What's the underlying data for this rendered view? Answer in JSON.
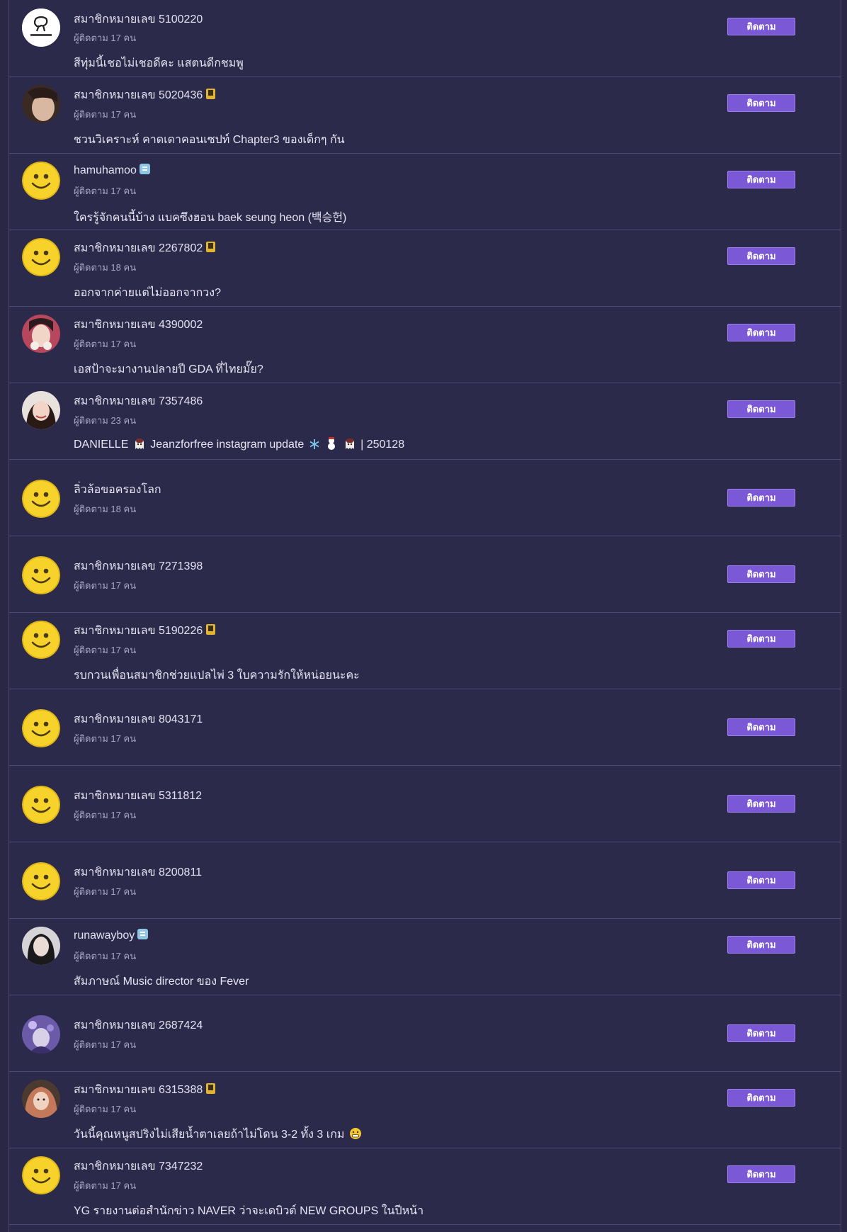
{
  "follow_label": "ติดตาม",
  "members": [
    {
      "name": "สมาชิกหมายเลข 5100220",
      "followers": "ผู้ติดตาม 17 คน",
      "topic": "สีทุ่มนี้เชอไม่เชอดีคะ แสตนดีกชมพู",
      "avatar": "logo-avatar",
      "badge": null
    },
    {
      "name": "สมาชิกหมายเลข 5020436",
      "followers": "ผู้ติดตาม 17 คน",
      "topic": "ชวนวิเคราะห์ คาดเดาคอนเซปท์ Chapter3 ของเด็กๆ กัน",
      "avatar": "photo-avatar",
      "badge": "phone-badge-icon"
    },
    {
      "name": "hamuhamoo",
      "followers": "ผู้ติดตาม 17 คน",
      "topic": "ใครรู้จักคนนี้บ้าง แบคซึงฮอน baek seung heon (백승헌)",
      "avatar": "smiley-avatar",
      "badge": "blue-badge-icon"
    },
    {
      "name": "สมาชิกหมายเลข 2267802",
      "followers": "ผู้ติดตาม 18 คน",
      "topic": "ออกจากค่ายแต่ไม่ออกจากวง?",
      "avatar": "smiley-avatar",
      "badge": "phone-badge-icon"
    },
    {
      "name": "สมาชิกหมายเลข 4390002",
      "followers": "ผู้ติดตาม 17 คน",
      "topic": "เอสป้าจะมางานปลายปี GDA ที่ไทยมั๊ย?",
      "avatar": "photo-avatar",
      "badge": null
    },
    {
      "name": "สมาชิกหมายเลข 7357486",
      "followers": "ผู้ติดตาม 23 คน",
      "topic_parts": [
        "DANIELLE",
        "Jeanzforfree instagram update",
        "| 250128"
      ],
      "avatar": "photo-avatar",
      "badge": null
    },
    {
      "name": "ลิ่วล้อขอครองโลก",
      "followers": "ผู้ติดตาม 18 คน",
      "topic": "",
      "avatar": "smiley-avatar",
      "badge": null
    },
    {
      "name": "สมาชิกหมายเลข 7271398",
      "followers": "ผู้ติดตาม 17 คน",
      "topic": "",
      "avatar": "smiley-avatar",
      "badge": null
    },
    {
      "name": "สมาชิกหมายเลข 5190226",
      "followers": "ผู้ติดตาม 17 คน",
      "topic": "รบกวนเพื่อนสมาชิกช่วยแปลไพ่ 3 ใบความรักให้หน่อยนะคะ",
      "avatar": "smiley-avatar",
      "badge": "phone-badge-icon"
    },
    {
      "name": "สมาชิกหมายเลข 8043171",
      "followers": "ผู้ติดตาม 17 คน",
      "topic": "",
      "avatar": "smiley-avatar",
      "badge": null
    },
    {
      "name": "สมาชิกหมายเลข 5311812",
      "followers": "ผู้ติดตาม 17 คน",
      "topic": "",
      "avatar": "smiley-avatar",
      "badge": null
    },
    {
      "name": "สมาชิกหมายเลข 8200811",
      "followers": "ผู้ติดตาม 17 คน",
      "topic": "",
      "avatar": "smiley-avatar",
      "badge": null
    },
    {
      "name": "runawayboy",
      "followers": "ผู้ติดตาม 17 คน",
      "topic": "สัมภาษณ์ Music director ของ Fever",
      "avatar": "photo-avatar",
      "badge": "blue-badge-icon"
    },
    {
      "name": "สมาชิกหมายเลข 2687424",
      "followers": "ผู้ติดตาม 17 คน",
      "topic": "",
      "avatar": "photo-avatar",
      "badge": null
    },
    {
      "name": "สมาชิกหมายเลข 6315388",
      "followers": "ผู้ติดตาม 17 คน",
      "topic": "วันนี้คุณหนูสปริงไม่เสียน้ำตาเลยถ้าไม่โดน 3-2 ทั้ง 3 เกม",
      "avatar": "photo-avatar",
      "badge": "phone-badge-icon"
    },
    {
      "name": "สมาชิกหมายเลข 7347232",
      "followers": "ผู้ติดตาม 17 คน",
      "topic": "YG รายงานต่อสำนักข่าว NAVER ว่าจะเดบิวต์ NEW GROUPS ในปีหน้า",
      "avatar": "smiley-avatar",
      "badge": null
    }
  ],
  "colors": {
    "accent": "#7b58d6",
    "background": "#2c2a4a",
    "divider": "#4d4a72"
  }
}
